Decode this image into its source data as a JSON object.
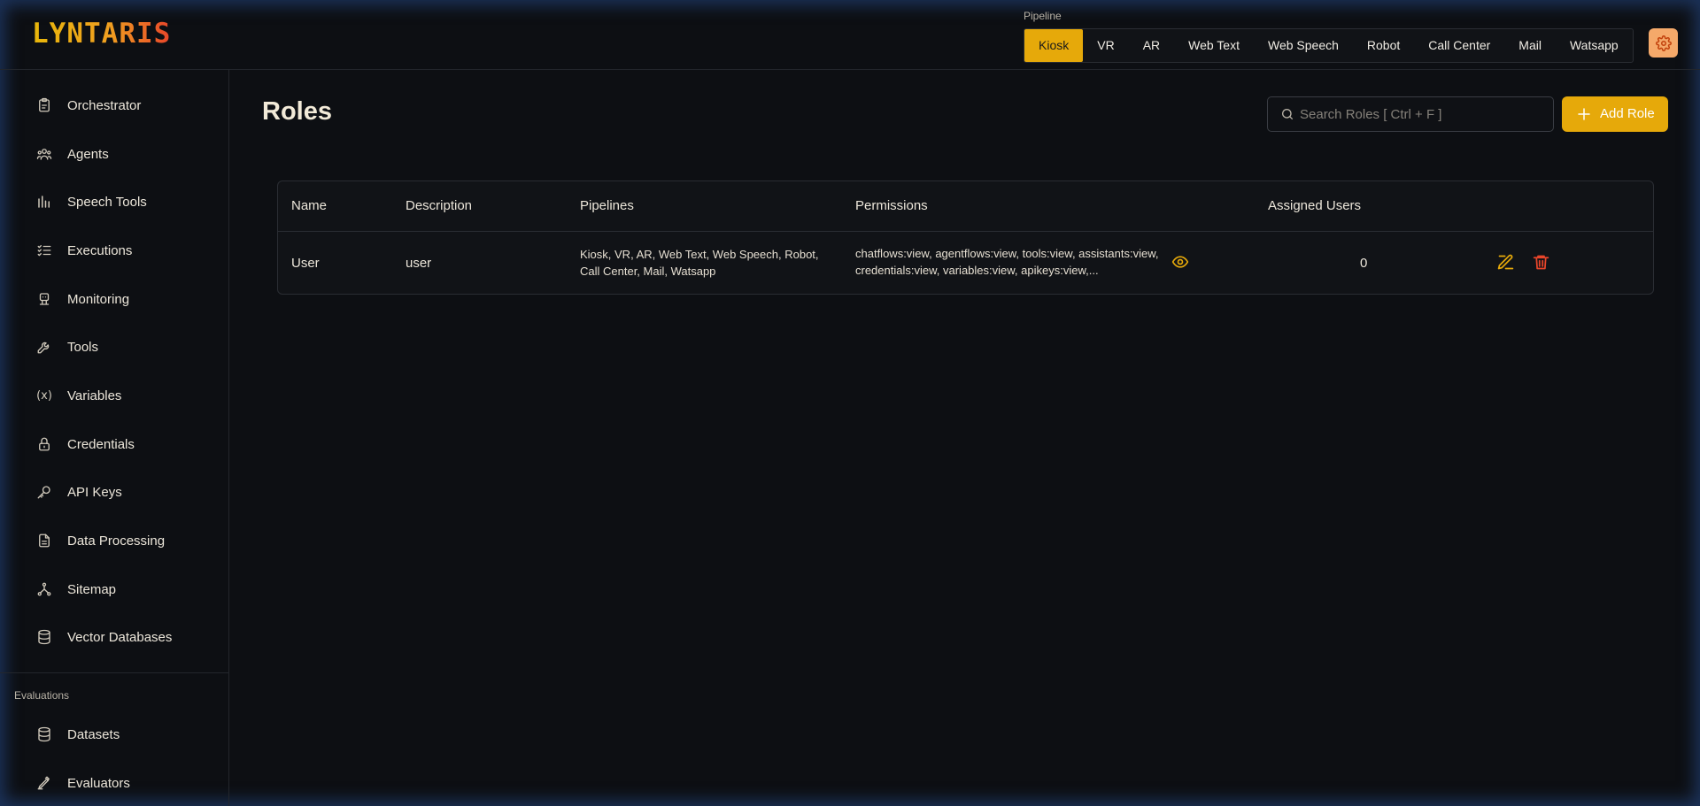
{
  "logo": {
    "text": "LYNTARIS"
  },
  "pipeline": {
    "label": "Pipeline",
    "tabs": [
      "Kiosk",
      "VR",
      "AR",
      "Web Text",
      "Web Speech",
      "Robot",
      "Call Center",
      "Mail",
      "Watsapp"
    ],
    "active": "Kiosk"
  },
  "sidebar": {
    "items": [
      {
        "label": "Orchestrator",
        "icon": "clipboard-icon"
      },
      {
        "label": "Agents",
        "icon": "users-icon"
      },
      {
        "label": "Speech Tools",
        "icon": "bars-chart-icon"
      },
      {
        "label": "Executions",
        "icon": "list-check-icon"
      },
      {
        "label": "Monitoring",
        "icon": "robot-icon"
      },
      {
        "label": "Tools",
        "icon": "wrench-icon"
      },
      {
        "label": "Variables",
        "icon": "variable-icon"
      },
      {
        "label": "Credentials",
        "icon": "lock-icon"
      },
      {
        "label": "API Keys",
        "icon": "key-icon"
      },
      {
        "label": "Data Processing",
        "icon": "document-icon"
      },
      {
        "label": "Sitemap",
        "icon": "sitemap-icon"
      },
      {
        "label": "Vector Databases",
        "icon": "database-icon"
      }
    ],
    "section_label": "Evaluations",
    "section_items": [
      {
        "label": "Datasets",
        "icon": "database-icon"
      },
      {
        "label": "Evaluators",
        "icon": "pen-ruler-icon"
      }
    ]
  },
  "main": {
    "title": "Roles",
    "search_placeholder": "Search Roles [ Ctrl + F ]",
    "add_button": "Add Role",
    "table": {
      "headers": [
        "Name",
        "Description",
        "Pipelines",
        "Permissions",
        "Assigned Users"
      ],
      "rows": [
        {
          "name": "User",
          "description": "user",
          "pipelines_line1": "Kiosk, VR, AR, Web Text, Web Speech, Robot,",
          "pipelines_line2": "Call Center, Mail, Watsapp",
          "permissions_line1": "chatflows:view, agentflows:view, tools:view, assistants:view,",
          "permissions_line2": "credentials:view, variables:view, apikeys:view,...",
          "assigned_users": "0"
        }
      ]
    }
  },
  "colors": {
    "accent": "#e6a90a",
    "danger": "#e8452a",
    "background": "#0d0f13"
  }
}
